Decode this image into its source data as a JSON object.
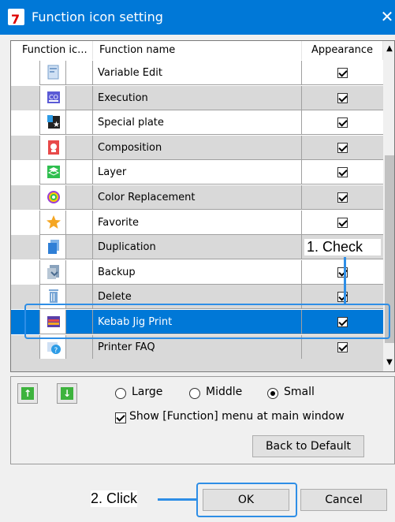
{
  "window": {
    "title": "Function icon setting",
    "close_glyph": "✕",
    "app_icon": "app-logo-icon"
  },
  "list": {
    "headers": [
      "Function ic...",
      "Function name",
      "Appearance"
    ],
    "rows": [
      {
        "name": "Variable Edit",
        "icon": "variable-edit-icon",
        "checked": true,
        "selected": false
      },
      {
        "name": "Execution",
        "icon": "execution-icon",
        "checked": true,
        "selected": false
      },
      {
        "name": "Special plate",
        "icon": "special-plate-icon",
        "checked": true,
        "selected": false
      },
      {
        "name": "Composition",
        "icon": "composition-icon",
        "checked": true,
        "selected": false
      },
      {
        "name": "Layer",
        "icon": "layer-icon",
        "checked": true,
        "selected": false
      },
      {
        "name": "Color Replacement",
        "icon": "color-replacement-icon",
        "checked": true,
        "selected": false
      },
      {
        "name": "Favorite",
        "icon": "favorite-star-icon",
        "checked": true,
        "selected": false
      },
      {
        "name": "Duplication",
        "icon": "duplication-icon",
        "checked": true,
        "selected": false
      },
      {
        "name": "Backup",
        "icon": "backup-icon",
        "checked": true,
        "selected": false
      },
      {
        "name": "Delete",
        "icon": "delete-trash-icon",
        "checked": true,
        "selected": false
      },
      {
        "name": "Kebab Jig Print",
        "icon": "kebab-jig-print-icon",
        "checked": true,
        "selected": true
      },
      {
        "name": "Printer FAQ",
        "icon": "printer-faq-icon",
        "checked": true,
        "selected": false
      }
    ]
  },
  "panel": {
    "up_glyph": "↑",
    "down_glyph": "↓",
    "size_options": [
      {
        "label": "Large",
        "selected": false
      },
      {
        "label": "Middle",
        "selected": false
      },
      {
        "label": "Small",
        "selected": true
      }
    ],
    "show_menu_label": "Show [Function] menu at main window",
    "show_menu_checked": true,
    "back_to_default": "Back to Default"
  },
  "footer": {
    "ok": "OK",
    "cancel": "Cancel"
  },
  "callouts": {
    "check": "1. Check",
    "click": "2. Click"
  },
  "colors": {
    "accent": "#0078d7",
    "callout": "#2e8ee6",
    "arrow_green": "#3db33d"
  }
}
